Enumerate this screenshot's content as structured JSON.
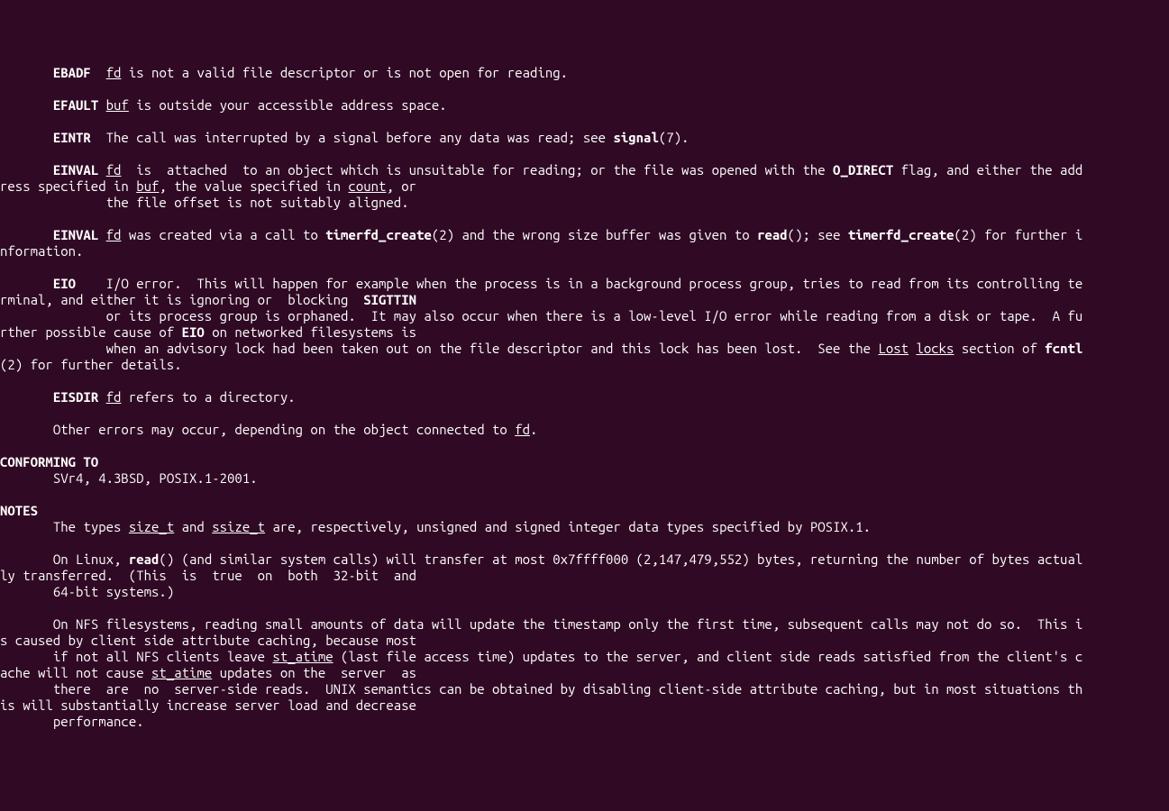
{
  "errors": {
    "ebadf": {
      "label": "EBADF",
      "arg": "fd",
      "desc": " is not a valid file descriptor or is not open for reading."
    },
    "efault": {
      "label": "EFAULT",
      "arg": "buf",
      "desc": " is outside your accessible address space."
    },
    "eintr": {
      "label": "EINTR",
      "desc": "  The call was interrupted by a signal before any data was read; see ",
      "ref": "signal",
      "refnum": "(7)."
    },
    "einval1": {
      "label": "EINVAL",
      "arg": "fd",
      "part1": "  is  attached  to an object which is unsuitable for reading; or the file was opened with the ",
      "flag": "O_DIRECT",
      "part2": " flag, and either the add",
      "line2a": "ress specified in ",
      "buf": "buf",
      "line2b": ", the value specified in ",
      "count": "count",
      "line2c": ", or",
      "line3": "              the file offset is not suitably aligned."
    },
    "einval2": {
      "label": "EINVAL",
      "arg": "fd",
      "part1": " was created via a call to ",
      "ref1": "timerfd_create",
      "ref1num": "(2) and the wrong size buffer was given to ",
      "readref": "read",
      "part2": "(); see ",
      "ref2": "timerfd_create",
      "ref2num": "(2) for further i",
      "line2": "nformation."
    },
    "eio": {
      "label": "EIO",
      "part1": "    I/O error.  This will happen for example when the process is in a background process group, tries to read from its controlling te",
      "line2a": "rminal, and either it is ignoring or  blocking  ",
      "sigttin": "SIGTTIN",
      "line3a": "              or its process group is orphaned.  It may also occur when there is a low-level I/O error while reading from a disk or tape.  A fu",
      "line4a": "rther possible cause of ",
      "eio2": "EIO",
      "line4b": " on networked filesystems is",
      "line5a": "              when an advisory lock had been taken out on the file descriptor and this lock has been lost.  See the ",
      "lost": "Lost",
      "locks": "locks",
      "line5b": " section of ",
      "fcntl": "fcntl",
      "line6": "(2) for further details."
    },
    "eisdir": {
      "label": "EISDIR",
      "arg": "fd",
      "desc": " refers to a directory."
    },
    "other": {
      "part1": "       Other errors may occur, depending on the object connected to ",
      "fd": "fd",
      "part2": "."
    }
  },
  "conforming": {
    "heading": "CONFORMING TO",
    "text": "       SVr4, 4.3BSD, POSIX.1-2001."
  },
  "notes": {
    "heading": "NOTES",
    "line1a": "       The types ",
    "sizet": "size_t",
    "line1b": " and ",
    "ssizet": "ssize_t",
    "line1c": " are, respectively, unsigned and signed integer data types specified by POSIX.1.",
    "line2a": "       On Linux, ",
    "read": "read",
    "line2b": "() (and similar system calls) will transfer at most 0x7ffff000 (2,147,479,552) bytes, returning the number of bytes actual",
    "line2c": "ly transferred.  (This  is  true  on  both  32-bit  and",
    "line2d": "       64-bit systems.)",
    "line3a": "       On NFS filesystems, reading small amounts of data will update the timestamp only the first time, subsequent calls may not do so.  This i",
    "line3b": "s caused by client side attribute caching, because most",
    "line3c": "       if not all NFS clients leave ",
    "statime1": "st_atime",
    "line3d": " (last file access time) updates to the server, and client side reads satisfied from the client's c",
    "line3e": "ache will not cause ",
    "statime2": "st_atime",
    "line3f": " updates on the  server  as",
    "line3g": "       there  are  no  server-side reads.  UNIX semantics can be obtained by disabling client-side attribute caching, but in most situations th",
    "line3h": "is will substantially increase server load and decrease",
    "line3i": "       performance."
  }
}
